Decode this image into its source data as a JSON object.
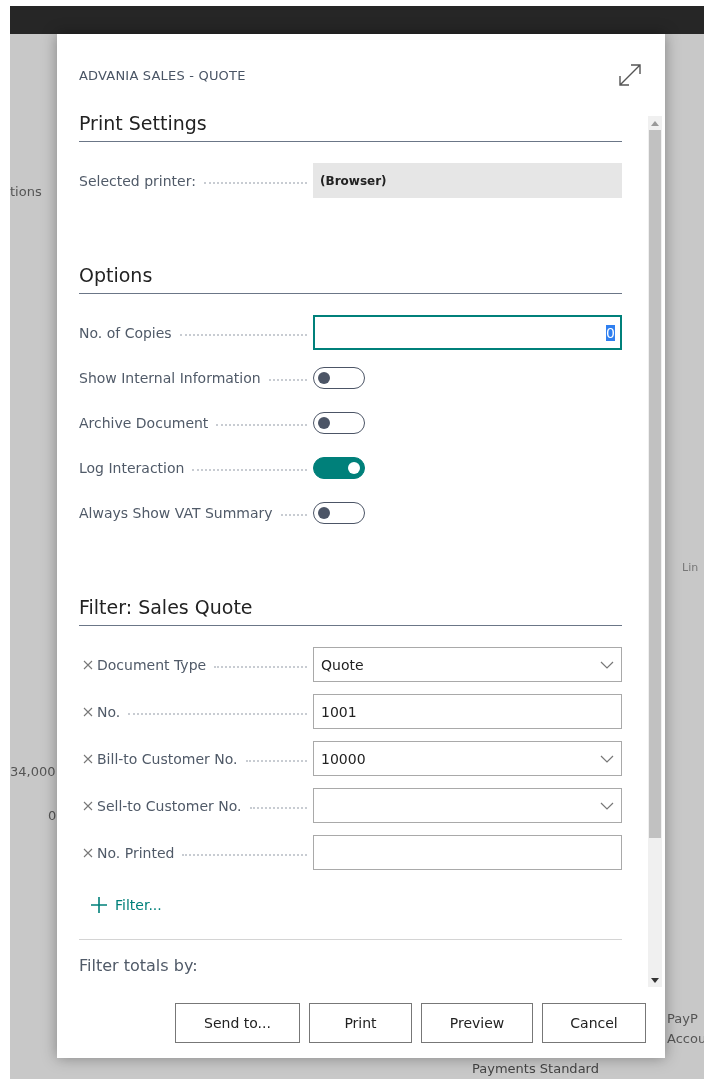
{
  "backdrop": {
    "texts": [
      "tions",
      "Lin",
      "34,000",
      "0",
      "PayP",
      "Accou",
      "Payments Standard"
    ]
  },
  "dialog": {
    "title": "ADVANIA SALES - QUOTE"
  },
  "sections": [
    {
      "title": "Print Settings",
      "fields": [
        {
          "kind": "readonly",
          "label": "Selected printer:",
          "value": "(Browser)"
        }
      ]
    },
    {
      "title": "Options",
      "fields": [
        {
          "kind": "number",
          "label": "No. of Copies",
          "value": "0",
          "focused": true
        },
        {
          "kind": "toggle",
          "label": "Show Internal Information",
          "on": false
        },
        {
          "kind": "toggle",
          "label": "Archive Document",
          "on": false
        },
        {
          "kind": "toggle",
          "label": "Log Interaction",
          "on": true
        },
        {
          "kind": "toggle",
          "label": "Always Show VAT Summary",
          "on": false
        }
      ]
    },
    {
      "title": "Filter: Sales Quote",
      "fields": [
        {
          "kind": "dropdown",
          "label": "Document Type",
          "value": "Quote",
          "removable": true
        },
        {
          "kind": "text",
          "label": "No.",
          "value": "1001",
          "removable": true
        },
        {
          "kind": "dropdown",
          "label": "Bill-to Customer No.",
          "value": "10000",
          "removable": true
        },
        {
          "kind": "dropdown",
          "label": "Sell-to Customer No.",
          "removable": true
        },
        {
          "kind": "text",
          "label": "No. Printed",
          "removable": true
        }
      ],
      "add_filter": "Filter...",
      "totals_label": "Filter totals by:"
    }
  ],
  "buttons": [
    "Send to...",
    "Print",
    "Preview",
    "Cancel"
  ]
}
